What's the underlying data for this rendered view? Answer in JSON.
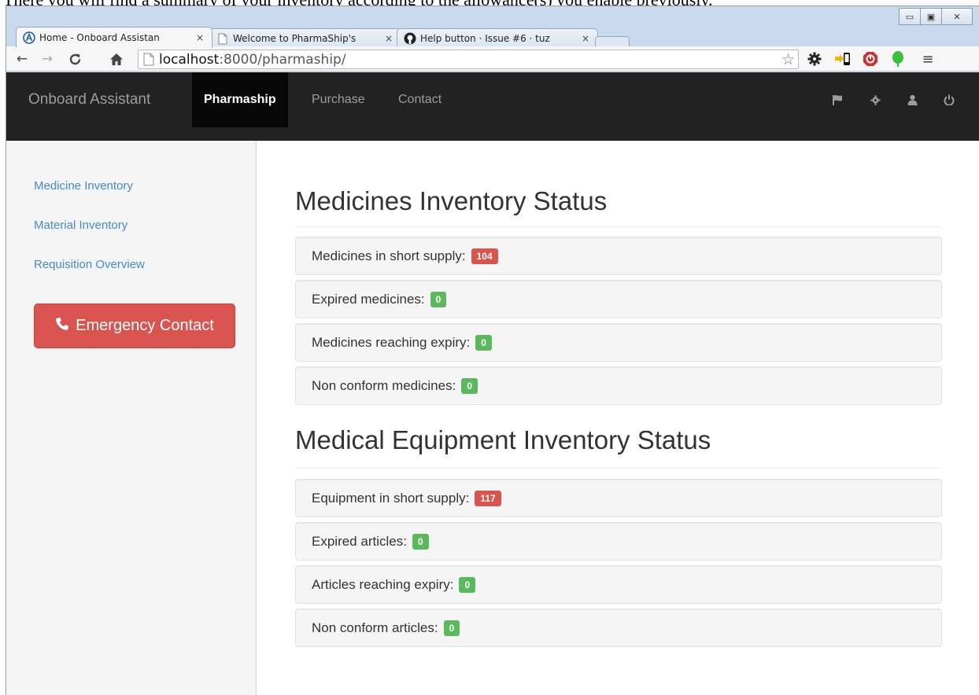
{
  "document": {
    "caption": "There you will find a summary of your inventory according to the allowance(s) you enable previously."
  },
  "browser": {
    "window_controls": {
      "minimize": "▭",
      "maximize": "▣",
      "close": "✕"
    },
    "tabs": [
      {
        "title": "Home - Onboard Assistan",
        "icon": "onboard-logo-icon",
        "active": true
      },
      {
        "title": "Welcome to PharmaShip's",
        "icon": "page-icon",
        "active": false
      },
      {
        "title": "Help button · Issue #6 · tuz",
        "icon": "github-icon",
        "active": false
      }
    ],
    "tab_close": "×",
    "address": {
      "host": "localhost",
      "path": ":8000/pharmaship/"
    }
  },
  "navbar": {
    "brand": "Onboard Assistant",
    "items": [
      {
        "label": "Pharmaship",
        "active": true
      },
      {
        "label": "Purchase",
        "active": false
      },
      {
        "label": "Contact",
        "active": false
      }
    ]
  },
  "sidebar": {
    "links": [
      "Medicine Inventory",
      "Material Inventory",
      "Requisition Overview"
    ],
    "emergency_button": "Emergency Contact"
  },
  "main": {
    "sections": [
      {
        "title": "Medicines Inventory Status",
        "rows": [
          {
            "label": "Medicines in short supply:",
            "count": "104",
            "status": "danger"
          },
          {
            "label": "Expired medicines:",
            "count": "0",
            "status": "success"
          },
          {
            "label": "Medicines reaching expiry:",
            "count": "0",
            "status": "success"
          },
          {
            "label": "Non conform medicines:",
            "count": "0",
            "status": "success"
          }
        ]
      },
      {
        "title": "Medical Equipment Inventory Status",
        "rows": [
          {
            "label": "Equipment in short supply:",
            "count": "117",
            "status": "danger"
          },
          {
            "label": "Expired articles:",
            "count": "0",
            "status": "success"
          },
          {
            "label": "Articles reaching expiry:",
            "count": "0",
            "status": "success"
          },
          {
            "label": "Non conform articles:",
            "count": "0",
            "status": "success"
          }
        ]
      }
    ]
  },
  "colors": {
    "navbar": "#222222",
    "link": "#428bca",
    "danger": "#d9534f",
    "success": "#5cb85c"
  }
}
